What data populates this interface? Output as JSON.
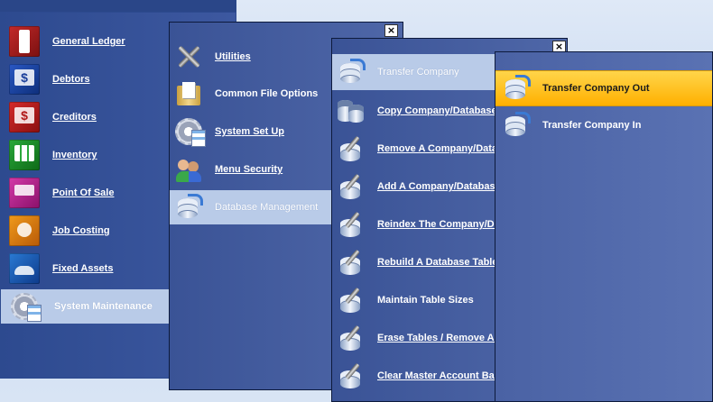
{
  "main_menu": {
    "items": [
      {
        "label": "General Ledger",
        "icon": "ledger-icon"
      },
      {
        "label": "Debtors",
        "icon": "debtors-icon"
      },
      {
        "label": "Creditors",
        "icon": "creditors-icon"
      },
      {
        "label": "Inventory",
        "icon": "inventory-icon"
      },
      {
        "label": "Point Of Sale",
        "icon": "point-of-sale-icon"
      },
      {
        "label": "Job Costing",
        "icon": "job-costing-icon"
      },
      {
        "label": "Fixed Assets",
        "icon": "fixed-assets-icon"
      },
      {
        "label": "System Maintenance",
        "icon": "system-maintenance-icon"
      }
    ],
    "selected": "System Maintenance"
  },
  "system_maintenance_menu": {
    "close": "×",
    "items": [
      {
        "label": "Utilities",
        "icon": "tools-icon"
      },
      {
        "label": "Common File Options",
        "icon": "folder-icon"
      },
      {
        "label": "System Set Up",
        "icon": "settings-gear-icon"
      },
      {
        "label": "Menu Security",
        "icon": "users-icon"
      },
      {
        "label": "Database Management",
        "icon": "database-icon"
      }
    ],
    "selected": "Database Management"
  },
  "database_management_menu": {
    "close": "×",
    "items": [
      {
        "label": "Transfer Company",
        "icon": "database-transfer-icon"
      },
      {
        "label": "Copy Company/Database",
        "icon": "database-copy-icon"
      },
      {
        "label": "Remove A Company/Databa",
        "icon": "database-wrench-icon"
      },
      {
        "label": "Add A Company/Database",
        "icon": "database-wrench-icon"
      },
      {
        "label": "Reindex The Company/Data",
        "icon": "database-wrench-icon"
      },
      {
        "label": "Rebuild A Database Table",
        "icon": "database-wrench-icon"
      },
      {
        "label": "Maintain Table Sizes",
        "icon": "database-wrench-icon"
      },
      {
        "label": "Erase Tables / Remove Acc",
        "icon": "database-wrench-icon"
      },
      {
        "label": "Clear Master Account Balan",
        "icon": "database-wrench-icon"
      }
    ],
    "selected": "Transfer Company"
  },
  "transfer_company_menu": {
    "items": [
      {
        "label": "Transfer Company Out",
        "icon": "database-transfer-icon"
      },
      {
        "label": "Transfer Company In",
        "icon": "database-transfer-icon"
      }
    ],
    "highlighted": "Transfer Company Out"
  },
  "colors": {
    "panel_blue": "#3d58a0",
    "selected_bg": "#b9cbe8",
    "highlight_gold": "#ffc21a"
  }
}
